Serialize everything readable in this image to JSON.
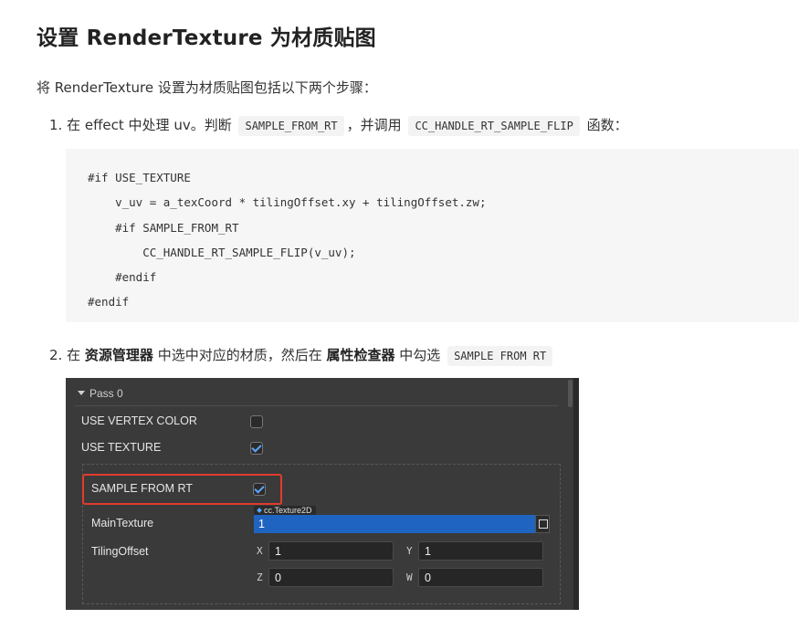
{
  "heading": "设置 RenderTexture 为材质贴图",
  "intro": "将 RenderTexture 设置为材质贴图包括以下两个步骤：",
  "step1": {
    "num": "1.",
    "pre": "在 effect 中处理 uv。判断",
    "code1": "SAMPLE_FROM_RT",
    "mid": "，并调用",
    "code2": "CC_HANDLE_RT_SAMPLE_FLIP",
    "post": "函数："
  },
  "code_block": "#if USE_TEXTURE\n    v_uv = a_texCoord * tilingOffset.xy + tilingOffset.zw;\n    #if SAMPLE_FROM_RT\n        CC_HANDLE_RT_SAMPLE_FLIP(v_uv);\n    #endif\n#endif",
  "step2": {
    "num": "2.",
    "pre": "在",
    "bold1": "资源管理器",
    "mid": "中选中对应的材质，然后在",
    "bold2": "属性检查器",
    "post": "中勾选",
    "code": "SAMPLE FROM RT"
  },
  "inspector": {
    "pass_label": "Pass 0",
    "use_vertex_color": {
      "label": "USE VERTEX COLOR",
      "checked": false
    },
    "use_texture": {
      "label": "USE TEXTURE",
      "checked": true
    },
    "sample_from_rt": {
      "label": "SAMPLE FROM RT",
      "checked": true
    },
    "main_texture": {
      "label": "MainTexture",
      "type_tag": "cc.Texture2D",
      "value": "1"
    },
    "tiling_offset": {
      "label": "TilingOffset",
      "x_label": "X",
      "x": "1",
      "y_label": "Y",
      "y": "1",
      "z_label": "Z",
      "z": "0",
      "w_label": "W",
      "w": "0"
    },
    "colors": {
      "panel_bg": "#3a3a3a",
      "highlight": "#e23b2e",
      "selected_field": "#1f64c0",
      "check": "#5aa8ff"
    }
  }
}
